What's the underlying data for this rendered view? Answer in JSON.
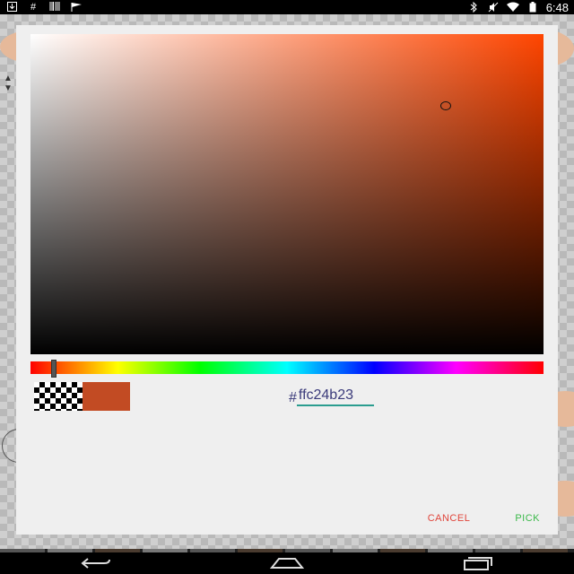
{
  "status_bar": {
    "time": "6:48",
    "left_icons": [
      "download-icon",
      "hash-icon",
      "barcode-icon",
      "flag-icon"
    ],
    "right_icons": [
      "bluetooth-icon",
      "mute-icon",
      "wifi-icon",
      "battery-icon"
    ]
  },
  "color_picker": {
    "hue_color": "#ff4500",
    "selected_color": "#c24b23",
    "hex_prefix": "#",
    "hex_value": "ffc24b23",
    "hue_fraction": 0.04
  },
  "actions": {
    "cancel_label": "CANCEL",
    "pick_label": "PICK"
  },
  "nav_bar": {
    "buttons": [
      "back-icon",
      "home-icon",
      "recents-icon"
    ]
  }
}
